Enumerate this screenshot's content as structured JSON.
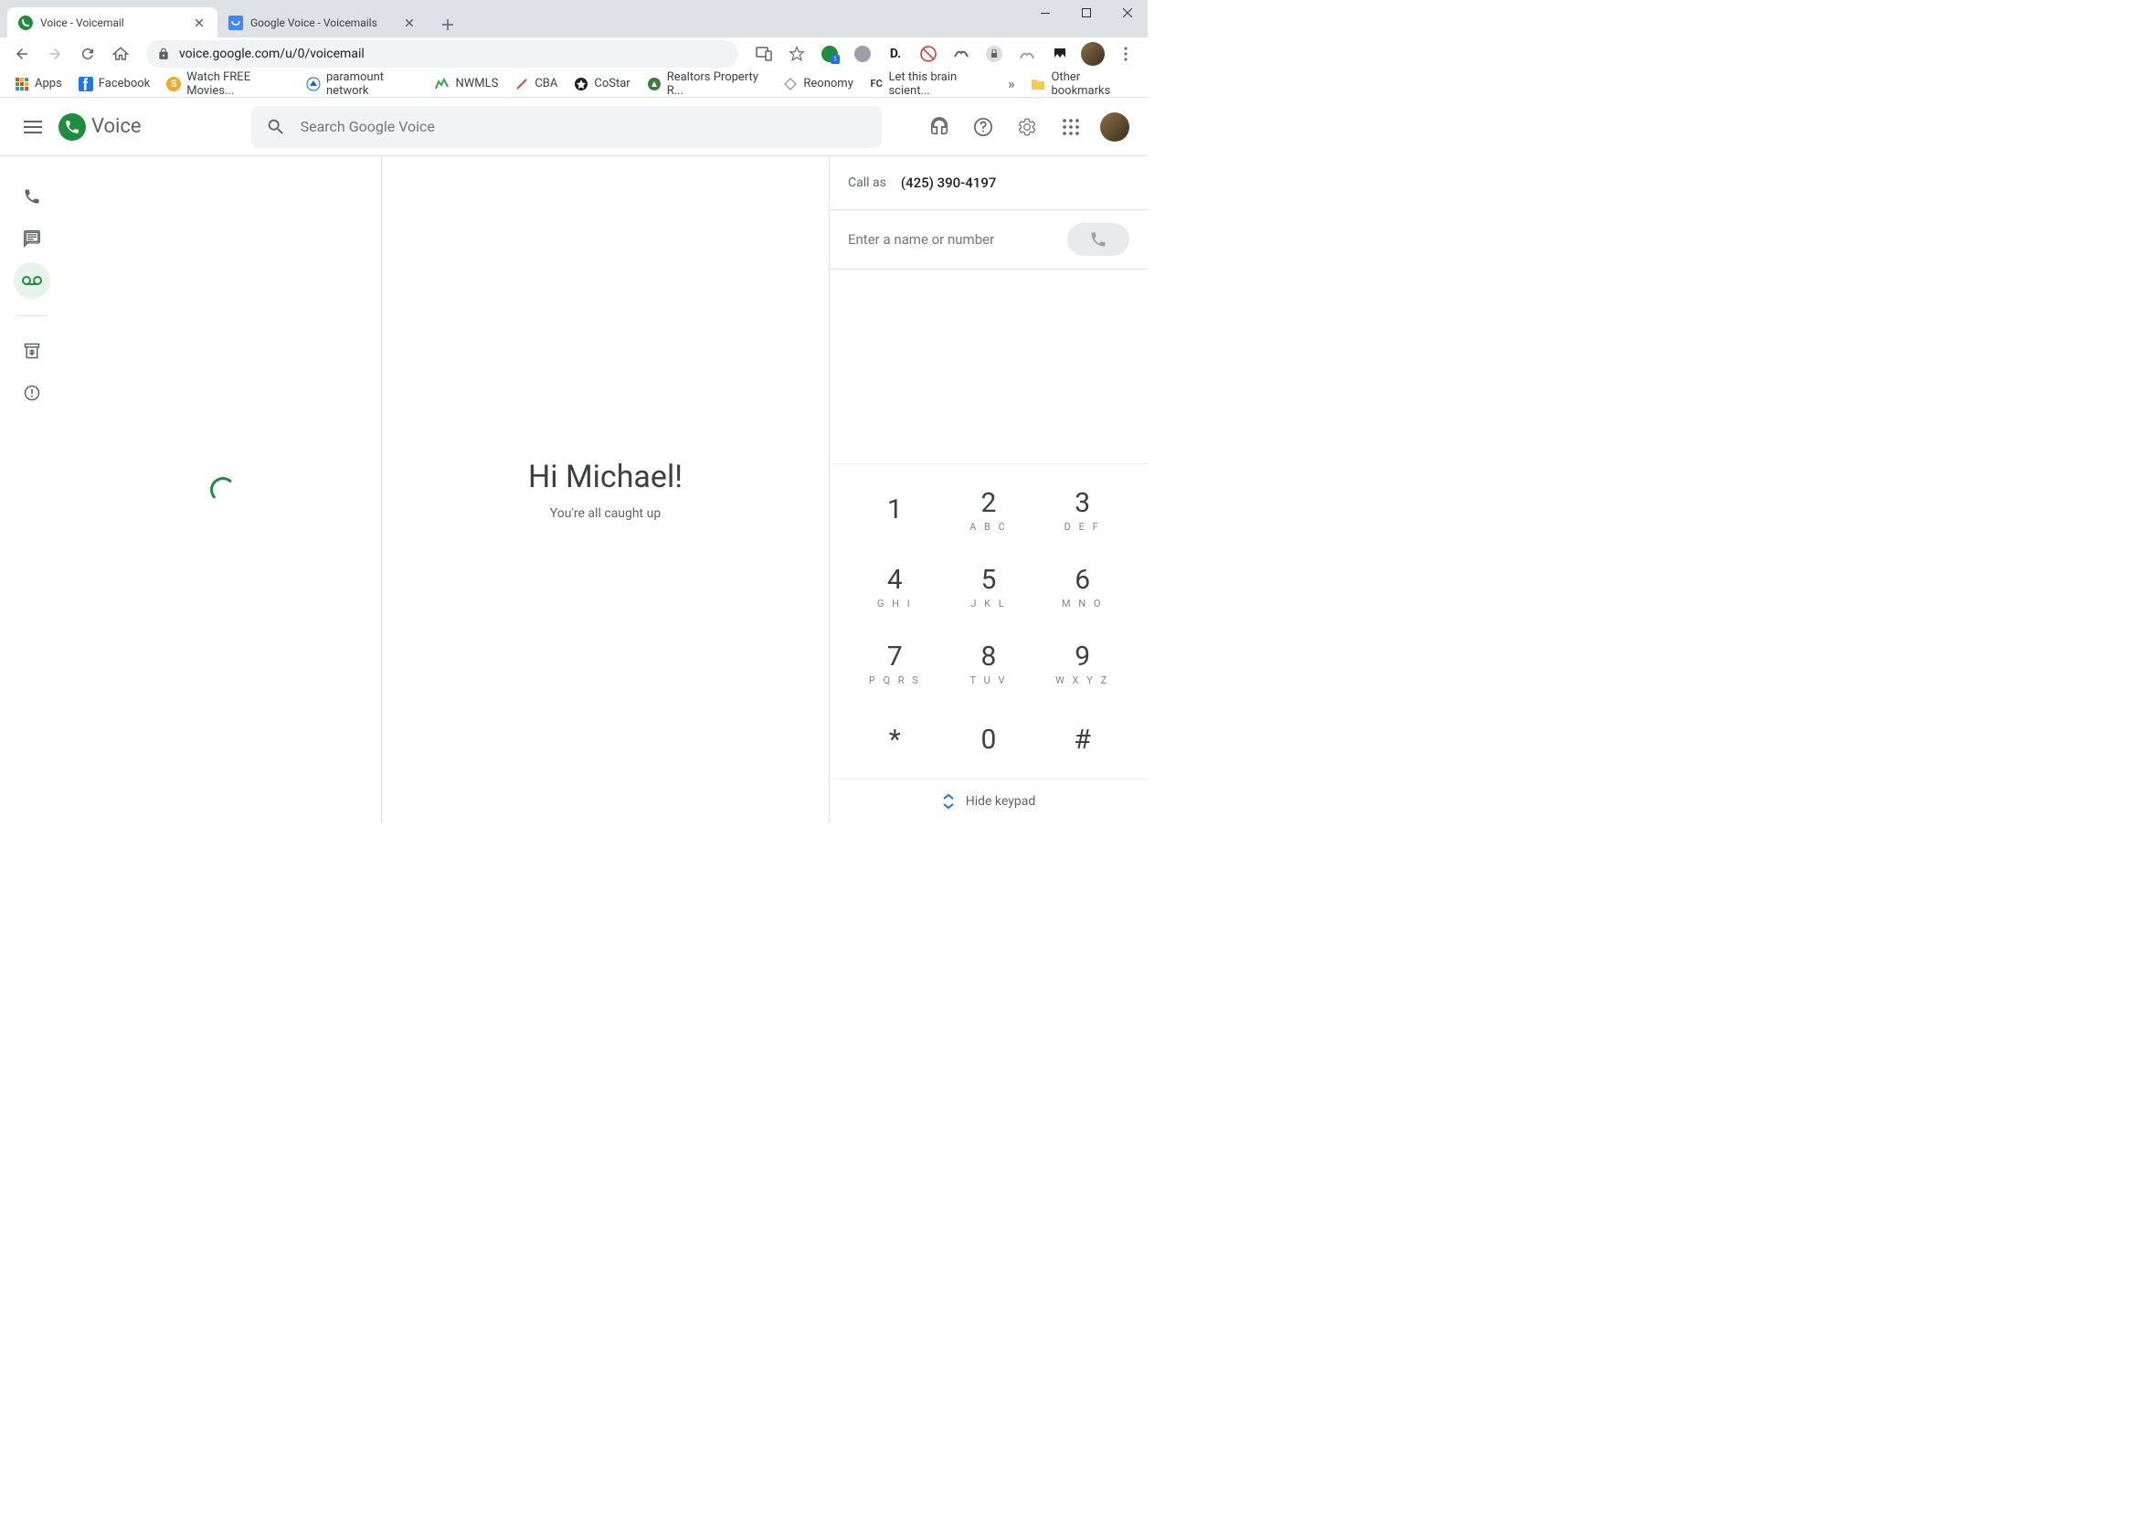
{
  "browser": {
    "tabs": [
      {
        "title": "Voice - Voicemail",
        "active": true
      },
      {
        "title": "Google Voice - Voicemails",
        "active": false
      }
    ],
    "url": "voice.google.com/u/0/voicemail",
    "bookmarks": [
      {
        "label": "Apps",
        "icon": "apps"
      },
      {
        "label": "Facebook",
        "icon": "fb"
      },
      {
        "label": "Watch FREE Movies...",
        "icon": "s"
      },
      {
        "label": "paramount network",
        "icon": "pn"
      },
      {
        "label": "NWMLS",
        "icon": "nw"
      },
      {
        "label": "CBA",
        "icon": "cba"
      },
      {
        "label": "CoStar",
        "icon": "cs"
      },
      {
        "label": "Realtors Property R...",
        "icon": "rp"
      },
      {
        "label": "Reonomy",
        "icon": "re"
      },
      {
        "label": "Let this brain scient...",
        "icon": "fc"
      }
    ],
    "other_bookmarks": "Other bookmarks"
  },
  "app": {
    "name": "Voice",
    "search_placeholder": "Search Google Voice",
    "greeting": "Hi Michael!",
    "caught_up_text": "You're all caught up",
    "call_as_label": "Call as",
    "call_as_number": "(425) 390-4197",
    "dial_placeholder": "Enter a name or number",
    "hide_keypad_label": "Hide keypad",
    "keypad": [
      {
        "num": "1",
        "letters": ""
      },
      {
        "num": "2",
        "letters": "A B C"
      },
      {
        "num": "3",
        "letters": "D E F"
      },
      {
        "num": "4",
        "letters": "G H I"
      },
      {
        "num": "5",
        "letters": "J K L"
      },
      {
        "num": "6",
        "letters": "M N O"
      },
      {
        "num": "7",
        "letters": "P Q R S"
      },
      {
        "num": "8",
        "letters": "T U V"
      },
      {
        "num": "9",
        "letters": "W X Y Z"
      },
      {
        "num": "*",
        "letters": ""
      },
      {
        "num": "0",
        "letters": ""
      },
      {
        "num": "#",
        "letters": ""
      }
    ]
  }
}
